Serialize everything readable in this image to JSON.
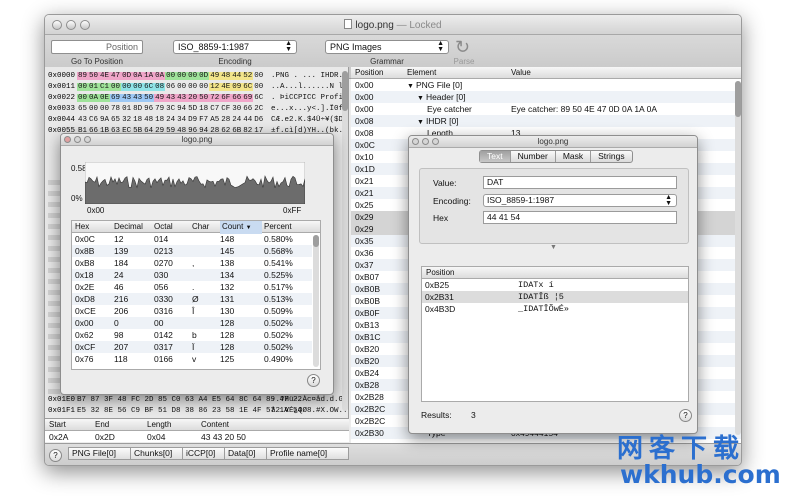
{
  "window": {
    "title": "logo.png",
    "title_suffix": "— Locked"
  },
  "toolbar": {
    "goto_value": "Position",
    "goto_caption": "Go To Position",
    "encoding_value": "ISO_8859-1:1987",
    "encoding_caption": "Encoding",
    "grammar_value": "PNG Images",
    "grammar_caption": "Grammar",
    "parse_caption": "Parse"
  },
  "hex_rows": [
    {
      "offset": "0x0000",
      "bytes": "89 50 4E 47 0D 0A 1A 0A 00 00 00 0D 49 48 44 52 00",
      "ascii": ".PNG  . ... IHDR."
    },
    {
      "offset": "0x0011",
      "bytes": "00 01 C1 00 00 00 6C 08 06 00 00 00 12 4E 09 6C 00",
      "ascii": "..A...l......N l."
    },
    {
      "offset": "0x0022",
      "bytes": "00 0A 0E 69 43 43 50 49 43 43 20 50 72 6F 66 69 6C",
      "ascii": ". ÞiCCPICC Profil"
    },
    {
      "offset": "0x0033",
      "bytes": "65 00 00 78 01 8D 96 79 3C 94 5D 18 C7 CF 30 66 2C",
      "ascii": "e...x...y<.].Ï0f,"
    },
    {
      "offset": "0x0044",
      "bytes": "43 C6 9A 65 32 18 48 18 24 34 D9 F7 A5 28 24 44 D6",
      "ascii": "CÆ.e2.K.$4Ù÷¥($DÖ"
    },
    {
      "offset": "0x0055",
      "bytes": "B1 66 1B 63 EC 5B 64 29 59 48 96 94 28 62 6B 82 17",
      "ascii": "±f.cì[d)YH..(bk.."
    }
  ],
  "hex_bottom_rows": [
    {
      "offset": "0x01E0",
      "bytes": "B7 87 3F 48 FC 2D 85 C0 63 A4 E5 64 8C 64 89 47 22",
      "ascii": "·.?Hü-.Àc¤åd.d.G\""
    },
    {
      "offset": "0x01F1",
      "bytes": "E5 32 8E 56 C9 BF 51 D8 38 86 23 58 1E 4F 57 1A 54",
      "ascii": "å2.VÉ¿QØ8.#X.OW.T"
    }
  ],
  "selection_table": {
    "headers": [
      "Start",
      "End",
      "Length",
      "Content"
    ],
    "row": [
      "0x2A",
      "0x2D",
      "0x04",
      "43 43 20 50"
    ]
  },
  "tree": {
    "headers": [
      "Position",
      "Element",
      "Value"
    ],
    "rows": [
      {
        "pos": "0x00",
        "element": "PNG File [0]",
        "value": "",
        "indent": 0,
        "disclosure": "▼"
      },
      {
        "pos": "0x00",
        "element": "Header [0]",
        "value": "",
        "indent": 1,
        "disclosure": "▼"
      },
      {
        "pos": "0x00",
        "element": "Eye catcher",
        "value": "Eye catcher: 89 50 4E 47 0D 0A 1A 0A",
        "indent": 2,
        "disclosure": ""
      },
      {
        "pos": "0x08",
        "element": "IHDR [0]",
        "value": "",
        "indent": 1,
        "disclosure": "▼"
      },
      {
        "pos": "0x08",
        "element": "Length",
        "value": "13",
        "indent": 2,
        "disclosure": ""
      },
      {
        "pos": "0x0C",
        "element": "",
        "value": "",
        "indent": 0,
        "disclosure": ""
      },
      {
        "pos": "0x10",
        "element": "",
        "value": "",
        "indent": 0,
        "disclosure": ""
      },
      {
        "pos": "0x1D",
        "element": "",
        "value": "",
        "indent": 0,
        "disclosure": ""
      },
      {
        "pos": "0x21",
        "element": "",
        "value": "",
        "indent": 0,
        "disclosure": ""
      },
      {
        "pos": "0x21",
        "element": "",
        "value": "",
        "indent": 0,
        "disclosure": ""
      },
      {
        "pos": "0x25",
        "element": "",
        "value": "",
        "indent": 0,
        "disclosure": ""
      },
      {
        "pos": "0x29",
        "element": "",
        "value": "",
        "indent": 0,
        "disclosure": ""
      },
      {
        "pos": "0x29",
        "element": "",
        "value": "",
        "indent": 0,
        "disclosure": ""
      },
      {
        "pos": "0x35",
        "element": "",
        "value": "",
        "indent": 0,
        "disclosure": ""
      },
      {
        "pos": "0x36",
        "element": "",
        "value": "",
        "indent": 0,
        "disclosure": ""
      },
      {
        "pos": "0x37",
        "element": "",
        "value": "",
        "indent": 0,
        "disclosure": ""
      },
      {
        "pos": "0xB07",
        "element": "",
        "value": "",
        "indent": 0,
        "disclosure": ""
      },
      {
        "pos": "0xB0B",
        "element": "",
        "value": "",
        "indent": 0,
        "disclosure": ""
      },
      {
        "pos": "0xB0B",
        "element": "",
        "value": "",
        "indent": 0,
        "disclosure": ""
      },
      {
        "pos": "0xB0F",
        "element": "",
        "value": "",
        "indent": 0,
        "disclosure": ""
      },
      {
        "pos": "0xB13",
        "element": "",
        "value": "",
        "indent": 0,
        "disclosure": ""
      },
      {
        "pos": "0xB1C",
        "element": "",
        "value": "",
        "indent": 0,
        "disclosure": ""
      },
      {
        "pos": "0xB20",
        "element": "",
        "value": "",
        "indent": 0,
        "disclosure": ""
      },
      {
        "pos": "0xB20",
        "element": "",
        "value": "",
        "indent": 0,
        "disclosure": ""
      },
      {
        "pos": "0xB24",
        "element": "",
        "value": "",
        "indent": 0,
        "disclosure": ""
      },
      {
        "pos": "0xB28",
        "element": "",
        "value": "",
        "indent": 0,
        "disclosure": ""
      },
      {
        "pos": "0x2B28",
        "element": "",
        "value": "",
        "indent": 0,
        "disclosure": ""
      },
      {
        "pos": "0x2B2C",
        "element": "",
        "value": "",
        "indent": 0,
        "disclosure": ""
      },
      {
        "pos": "0x2B2C",
        "element": "",
        "value": "",
        "indent": 0,
        "disclosure": ""
      },
      {
        "pos": "0x2B30",
        "element": "Type",
        "value": "0x49444154",
        "indent": 2,
        "disclosure": ""
      }
    ]
  },
  "breadcrumb": [
    "PNG File[0]",
    "Chunks[0]",
    "iCCP[0]",
    "Data[0]",
    "Profile name[0]"
  ],
  "stats_panel": {
    "title": "logo.png",
    "max_label": "0.58%",
    "min_label": "0%",
    "x_start": "0x00",
    "x_end": "0xFF",
    "headers": [
      "Hex",
      "Decimal",
      "Octal",
      "Char",
      "Count",
      "Percent"
    ],
    "sorted_column": "Count",
    "rows": [
      [
        "0x0C",
        "12",
        "014",
        "",
        "148",
        "0.580%"
      ],
      [
        "0x8B",
        "139",
        "0213",
        "",
        "145",
        "0.568%"
      ],
      [
        "0xB8",
        "184",
        "0270",
        ",",
        "138",
        "0.541%"
      ],
      [
        "0x18",
        "24",
        "030",
        "",
        "134",
        "0.525%"
      ],
      [
        "0x2E",
        "46",
        "056",
        ".",
        "132",
        "0.517%"
      ],
      [
        "0xD8",
        "216",
        "0330",
        "Ø",
        "131",
        "0.513%"
      ],
      [
        "0xCE",
        "206",
        "0316",
        "Î",
        "130",
        "0.509%"
      ],
      [
        "0x00",
        "0",
        "00",
        "",
        "128",
        "0.502%"
      ],
      [
        "0x62",
        "98",
        "0142",
        "b",
        "128",
        "0.502%"
      ],
      [
        "0xCF",
        "207",
        "0317",
        "Ï",
        "128",
        "0.502%"
      ],
      [
        "0x76",
        "118",
        "0166",
        "v",
        "125",
        "0.490%"
      ]
    ],
    "help": "?"
  },
  "search_panel": {
    "title": "logo.png",
    "tabs": [
      "Text",
      "Number",
      "Mask",
      "Strings"
    ],
    "active_tab": "Text",
    "value_label": "Value:",
    "value": "DAT",
    "encoding_label": "Encoding:",
    "encoding": "ISO_8859-1:1987",
    "hex_label": "Hex",
    "hex": "44 41 54",
    "results_header": "Position",
    "results": [
      {
        "pos": "0xB25",
        "match": "IDATx í"
      },
      {
        "pos": "0x2B31",
        "match": "IDATÎß ¦5"
      },
      {
        "pos": "0x4B3D",
        "match": "_IDATÎÕwÉ»"
      }
    ],
    "results_label": "Results:",
    "results_count": "3",
    "help": "?"
  },
  "watermark": {
    "cn": "网客下载",
    "en": "wkhub.com"
  },
  "colors": {
    "highlight_green": "#9fe39a",
    "highlight_yellow": "#f2e48a",
    "highlight_blue": "#9cc8f5",
    "highlight_pink": "#f0a6c9",
    "highlight_cyan": "#8fe3e6",
    "watermark": "#2b6fcf"
  }
}
